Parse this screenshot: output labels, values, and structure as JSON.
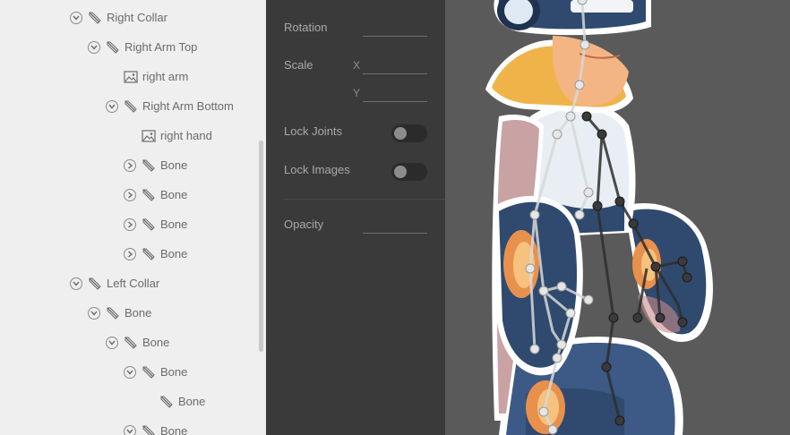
{
  "tree": {
    "items": [
      {
        "label": "Right Collar",
        "type": "bone",
        "depth": 0,
        "toggle": "expanded"
      },
      {
        "label": "Right Arm Top",
        "type": "bone",
        "depth": 1,
        "toggle": "expanded"
      },
      {
        "label": "right arm",
        "type": "image",
        "depth": 2,
        "toggle": "none"
      },
      {
        "label": "Right Arm Bottom",
        "type": "bone",
        "depth": 2,
        "toggle": "expanded"
      },
      {
        "label": "right hand",
        "type": "image",
        "depth": 3,
        "toggle": "none"
      },
      {
        "label": "Bone",
        "type": "bone",
        "depth": 3,
        "toggle": "collapsed"
      },
      {
        "label": "Bone",
        "type": "bone",
        "depth": 3,
        "toggle": "collapsed"
      },
      {
        "label": "Bone",
        "type": "bone",
        "depth": 3,
        "toggle": "collapsed"
      },
      {
        "label": "Bone",
        "type": "bone",
        "depth": 3,
        "toggle": "collapsed"
      },
      {
        "label": "Left Collar",
        "type": "bone",
        "depth": 0,
        "toggle": "expanded"
      },
      {
        "label": "Bone",
        "type": "bone",
        "depth": 1,
        "toggle": "expanded"
      },
      {
        "label": "Bone",
        "type": "bone",
        "depth": 2,
        "toggle": "expanded"
      },
      {
        "label": "Bone",
        "type": "bone",
        "depth": 3,
        "toggle": "expanded"
      },
      {
        "label": "Bone",
        "type": "bone",
        "depth": 4,
        "toggle": "none"
      },
      {
        "label": "Bone",
        "type": "bone",
        "depth": 3,
        "toggle": "expanded"
      }
    ]
  },
  "properties": {
    "rotation": {
      "label": "Rotation",
      "value": ""
    },
    "scale": {
      "label": "Scale",
      "x_label": "X",
      "y_label": "Y",
      "x_value": "",
      "y_value": ""
    },
    "lock_joints": {
      "label": "Lock Joints",
      "on": false
    },
    "lock_images": {
      "label": "Lock Images",
      "on": false
    },
    "opacity": {
      "label": "Opacity",
      "value": ""
    }
  },
  "icons": {
    "bone": "bone-icon",
    "image": "image-icon",
    "expanded": "chevron-down-icon",
    "collapsed": "chevron-right-icon"
  },
  "colors": {
    "tree_bg": "#efefef",
    "panel_bg": "#3a3a3a",
    "canvas_bg": "#5a5a5a",
    "skeleton_light": "#d8d8d8",
    "skeleton_dark": "#2e2e2e",
    "character_navy": "#2f4a6e",
    "character_skin": "#f4b585",
    "character_shirt": "#e9eef4"
  }
}
